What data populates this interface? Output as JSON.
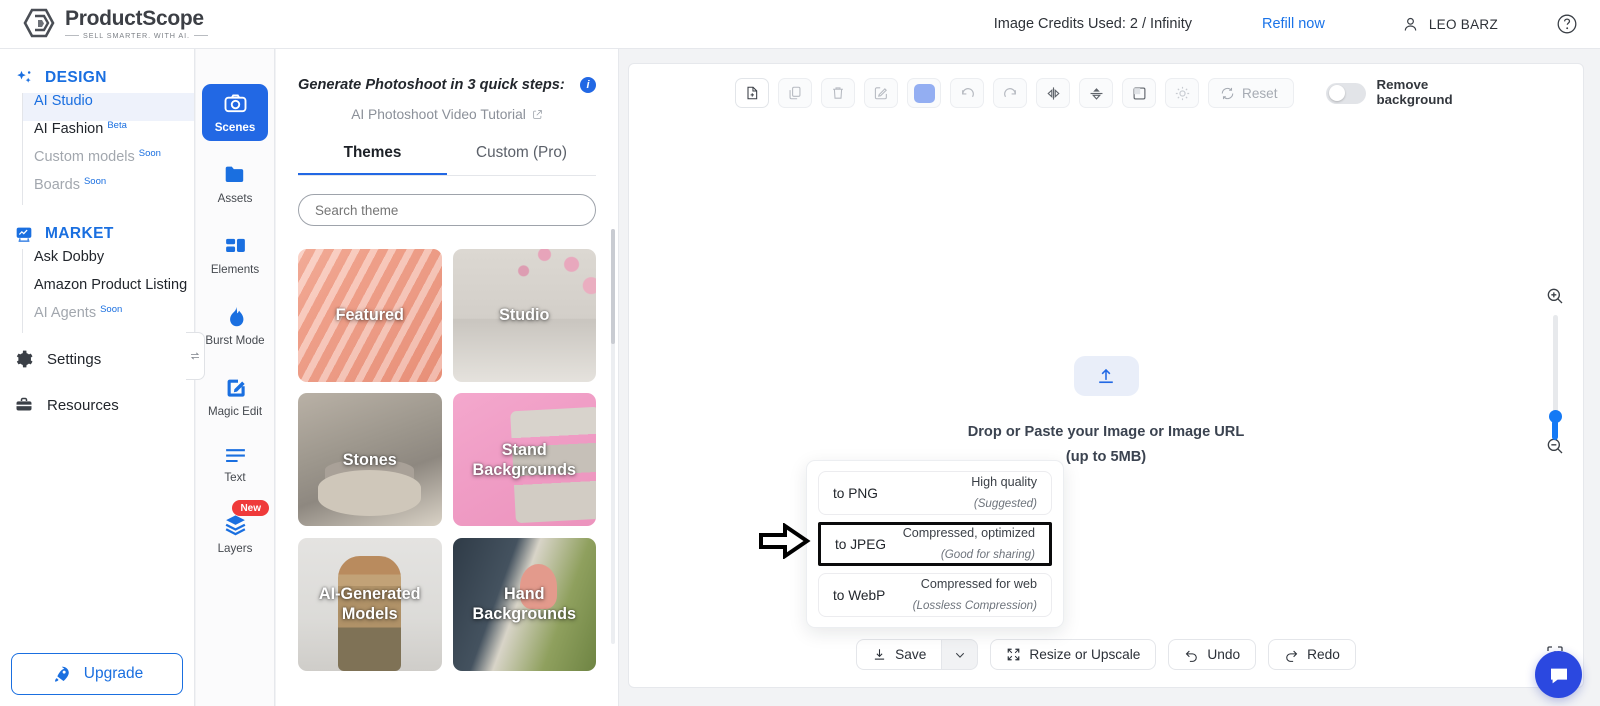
{
  "brand": {
    "name": "ProductScope",
    "tagline": "SELL SMARTER. WITH AI."
  },
  "topbar": {
    "credits": "Image Credits Used: 2 / Infinity",
    "refill": "Refill now",
    "user": "LEO BARZ",
    "help_icon": "help-circle-icon",
    "user_icon": "user-avatar-icon"
  },
  "sidebar": {
    "groups": [
      {
        "title": "DESIGN",
        "icon": "sparkles-icon",
        "items": [
          {
            "label": "AI Studio",
            "badge": "",
            "state": "active"
          },
          {
            "label": "AI Fashion",
            "badge": "Beta",
            "state": "normal"
          },
          {
            "label": "Custom models",
            "badge": "Soon",
            "state": "muted"
          },
          {
            "label": "Boards",
            "badge": "Soon",
            "state": "muted"
          }
        ]
      },
      {
        "title": "MARKET",
        "icon": "market-chart-icon",
        "items": [
          {
            "label": "Ask Dobby",
            "badge": "",
            "state": "normal"
          },
          {
            "label": "Amazon Product Listing",
            "badge": "",
            "state": "normal"
          },
          {
            "label": "AI Agents",
            "badge": "Soon",
            "state": "muted"
          }
        ]
      }
    ],
    "flat_items": [
      {
        "label": "Settings",
        "icon": "gear-icon"
      },
      {
        "label": "Resources",
        "icon": "briefcase-icon"
      }
    ],
    "upgrade": {
      "label": "Upgrade",
      "icon": "rocket-icon"
    },
    "collapse_icon": "collapse-panel-icon"
  },
  "rail": {
    "items": [
      {
        "label": "Scenes",
        "icon": "camera-icon",
        "active": true,
        "badge": ""
      },
      {
        "label": "Assets",
        "icon": "folder-icon",
        "active": false,
        "badge": ""
      },
      {
        "label": "Elements",
        "icon": "elements-icon",
        "active": false,
        "badge": ""
      },
      {
        "label": "Burst Mode",
        "icon": "flame-icon",
        "active": false,
        "badge": ""
      },
      {
        "label": "Magic Edit",
        "icon": "magic-pencil-icon",
        "active": false,
        "badge": ""
      },
      {
        "label": "Text",
        "icon": "text-lines-icon",
        "active": false,
        "badge": ""
      },
      {
        "label": "Layers",
        "icon": "layers-icon",
        "active": false,
        "badge": "New"
      }
    ]
  },
  "panel": {
    "title": "Generate Photoshoot in 3 quick steps:",
    "info_icon": "info-icon",
    "tutorial": "AI Photoshoot Video Tutorial",
    "tutorial_icon": "external-link-icon",
    "tabs": [
      {
        "label": "Themes",
        "active": true
      },
      {
        "label": "Custom (Pro)",
        "active": false
      }
    ],
    "search": {
      "value": "",
      "placeholder": "Search theme",
      "icon": "search-input"
    },
    "cards": [
      {
        "label": "Featured",
        "art": "art-featured"
      },
      {
        "label": "Studio",
        "art": "art-studio"
      },
      {
        "label": "Stones",
        "art": "art-stones"
      },
      {
        "label": "Stand\nBackgrounds",
        "art": "art-stand"
      },
      {
        "label": "AI-Generated\nModels",
        "art": "art-models"
      },
      {
        "label": "Hand\nBackgrounds",
        "art": "art-hand"
      }
    ]
  },
  "canvas": {
    "toolbar": [
      {
        "icon": "add-file-icon",
        "name": "new-file-button"
      },
      {
        "icon": "copy-icon",
        "name": "duplicate-button"
      },
      {
        "icon": "trash-icon",
        "name": "delete-button"
      },
      {
        "icon": "edit-square-icon",
        "name": "edit-button"
      },
      {
        "icon": "color-swatch-icon",
        "name": "color-swatch-button"
      },
      {
        "icon": "undo-arrow-icon",
        "name": "toolbar-undo-button"
      },
      {
        "icon": "redo-arrow-icon",
        "name": "toolbar-redo-button"
      },
      {
        "icon": "flip-horizontal-icon",
        "name": "flip-horizontal-button"
      },
      {
        "icon": "flip-vertical-icon",
        "name": "flip-vertical-button"
      },
      {
        "icon": "crop-square-icon",
        "name": "crop-button"
      },
      {
        "icon": "brightness-icon",
        "name": "brightness-button"
      }
    ],
    "reset": {
      "label": "Reset",
      "icon": "reset-icon"
    },
    "remove_background": {
      "label_line1": "Remove",
      "label_line2": "background",
      "on": false
    },
    "dropzone": {
      "icon": "upload-icon",
      "line1": "Drop or Paste your Image or Image URL",
      "line2": "(up to 5MB)"
    },
    "zoom": {
      "in_icon": "zoom-in-icon",
      "out_icon": "zoom-out-icon",
      "value": 5
    },
    "focus_icon": "focus-target-icon",
    "actions": [
      {
        "label": "Save",
        "icon": "download-icon",
        "name": "save-button"
      },
      {
        "label": "Resize or Upscale",
        "icon": "expand-icon",
        "name": "resize-upscale-button"
      },
      {
        "label": "Undo",
        "icon": "undo-icon",
        "name": "undo-button"
      },
      {
        "label": "Redo",
        "icon": "redo-icon",
        "name": "redo-button"
      }
    ],
    "save_caret_icon": "chevron-down-icon"
  },
  "export_menu": {
    "options": [
      {
        "name": "to PNG",
        "meta1": "High quality",
        "meta2": "(Suggested)",
        "highlighted": false
      },
      {
        "name": "to JPEG",
        "meta1": "Compressed, optimized",
        "meta2": "(Good for sharing)",
        "highlighted": true
      },
      {
        "name": "to WebP",
        "meta1": "Compressed for web",
        "meta2": "(Lossless Compression)",
        "highlighted": false
      }
    ],
    "annotation_icon": "arrow-right-annotation"
  },
  "chat": {
    "icon": "chat-bubble-icon"
  },
  "colors": {
    "accent_blue": "#2268e4",
    "link_blue": "#1a73e8",
    "badge_red": "#ef3a3a",
    "canvas_bg": "#f2f3f5",
    "swatch": "#93aef2",
    "chat_blue": "#2b48e0"
  }
}
